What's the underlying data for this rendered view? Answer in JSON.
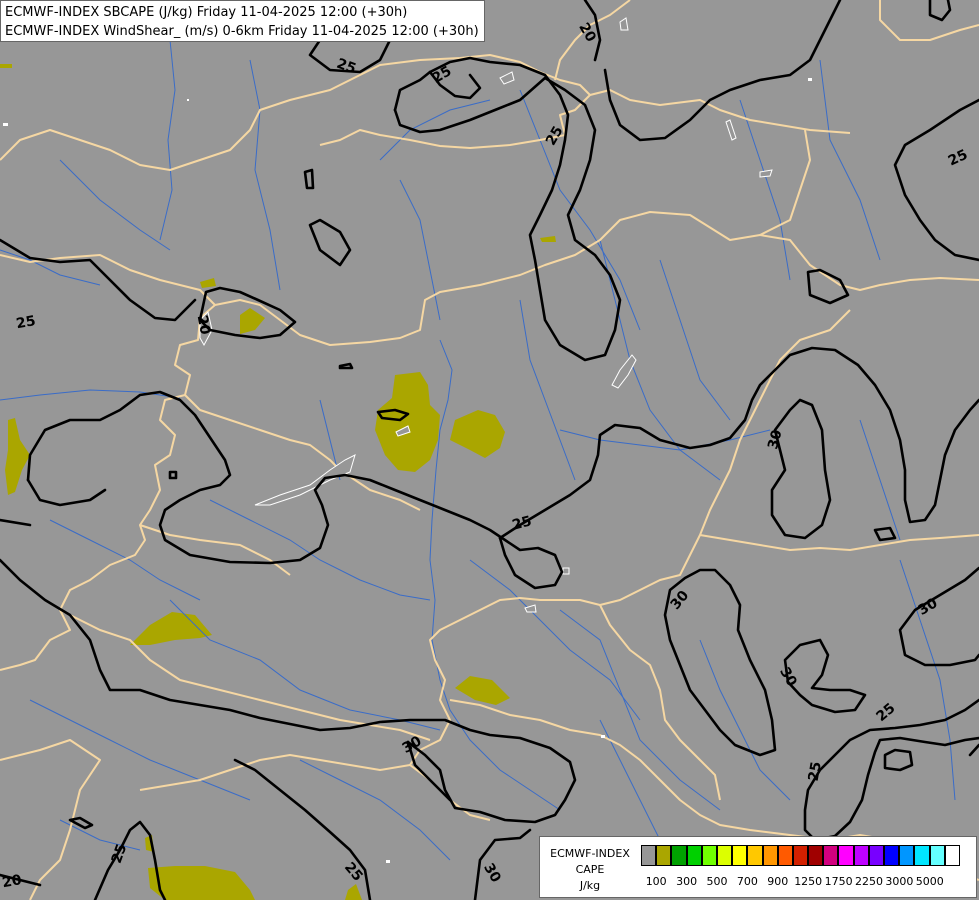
{
  "titles": {
    "line1": "ECMWF-INDEX SBCAPE (J/kg) Friday 11-04-2025 12:00 (+30h)",
    "line2": "ECMWF-INDEX WindShear_ (m/s) 0-6km Friday 11-04-2025 12:00 (+30h)"
  },
  "legend": {
    "title_line1": "ECMWF-INDEX",
    "title_line2": "CAPE",
    "title_line3": "J/kg",
    "colors": [
      "#979797",
      "#aaa600",
      "#00a000",
      "#00d000",
      "#70ff00",
      "#dcff00",
      "#ffff00",
      "#ffc800",
      "#ff9600",
      "#ff5a00",
      "#d22000",
      "#a00000",
      "#d2007f",
      "#ff00ff",
      "#be00ff",
      "#7800ff",
      "#0000ff",
      "#0096ff",
      "#00e6ff",
      "#64ffff",
      "#ffffff"
    ],
    "tick_labels": [
      "100",
      "300",
      "500",
      "700",
      "900",
      "1250",
      "1750",
      "2250",
      "3000",
      "5000"
    ]
  },
  "colors": {
    "background": "#979797",
    "border": "#f5d7a3",
    "river": "#3a6cc8",
    "contour": "#000000",
    "cape_fill": "#aaa600"
  },
  "contour_labels": [
    "25",
    "25",
    "20",
    "25",
    "25",
    "20",
    "25",
    "25",
    "30",
    "25",
    "30",
    "30",
    "30",
    "25",
    "30",
    "25",
    "25",
    "30",
    "20"
  ]
}
